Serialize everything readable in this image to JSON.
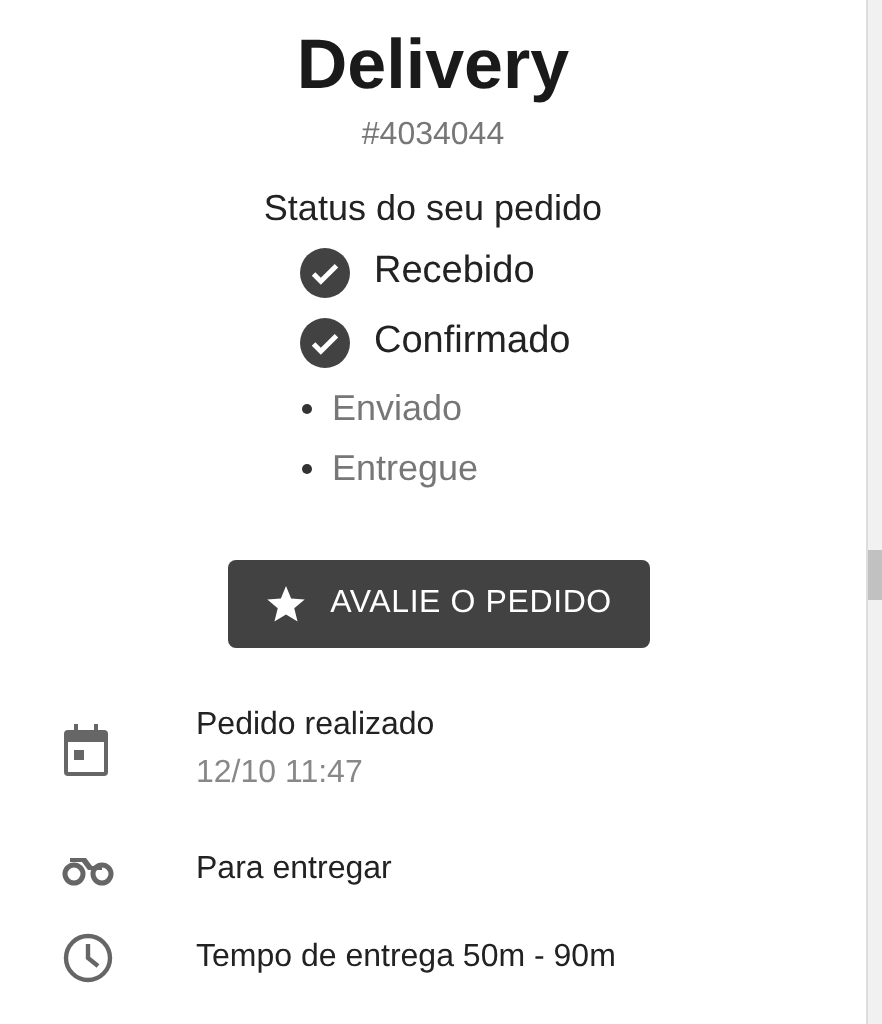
{
  "title": "Delivery",
  "order_number": "#4034044",
  "status_heading": "Status do seu pedido",
  "steps": [
    {
      "label": "Recebido",
      "done": true
    },
    {
      "label": "Confirmado",
      "done": true
    },
    {
      "label": "Enviado",
      "done": false
    },
    {
      "label": "Entregue",
      "done": false
    }
  ],
  "rate_button": {
    "label": "AVALIE O PEDIDO"
  },
  "details": [
    {
      "kind": "calendar",
      "title": "Pedido realizado",
      "subtitle": "12/10 11:47"
    },
    {
      "kind": "motorcycle",
      "title": "Para entregar"
    },
    {
      "kind": "clock",
      "title": "Tempo de entrega 50m - 90m"
    }
  ]
}
